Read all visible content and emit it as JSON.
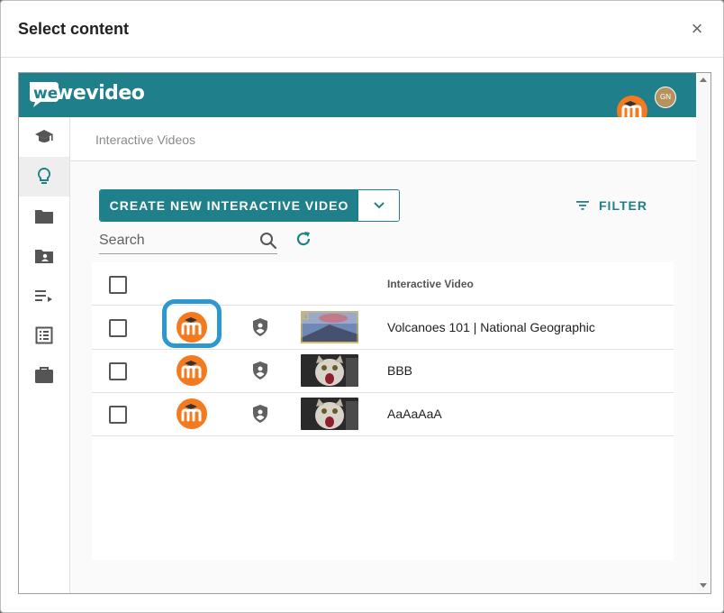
{
  "modal": {
    "title": "Select content",
    "close_glyph": "×"
  },
  "app": {
    "logo_text": "wevideo",
    "avatar_initials": "GN",
    "breadcrumb": "Interactive Videos"
  },
  "sidebar": {
    "items": [
      {
        "icon": "graduation-cap-icon",
        "active": false
      },
      {
        "icon": "lightbulb-icon",
        "active": true
      },
      {
        "icon": "folder-icon",
        "active": false
      },
      {
        "icon": "shared-folder-icon",
        "active": false
      },
      {
        "icon": "playlist-icon",
        "active": false
      },
      {
        "icon": "list-icon",
        "active": false
      },
      {
        "icon": "briefcase-icon",
        "active": false
      }
    ]
  },
  "toolbar": {
    "create_label": "CREATE NEW INTERACTIVE VIDEO",
    "filter_label": "FILTER",
    "search_placeholder": "Search"
  },
  "table": {
    "column_header": "Interactive Video",
    "rows": [
      {
        "title": "Volcanoes 101 | National Geographic",
        "thumb": "volcano"
      },
      {
        "title": "BBB",
        "thumb": "cat"
      },
      {
        "title": "AaAaAaA",
        "thumb": "cat"
      }
    ]
  },
  "colors": {
    "brand_teal": "#1f7f8b",
    "badge_orange": "#f47a20",
    "highlight_blue": "#2d97cf"
  }
}
